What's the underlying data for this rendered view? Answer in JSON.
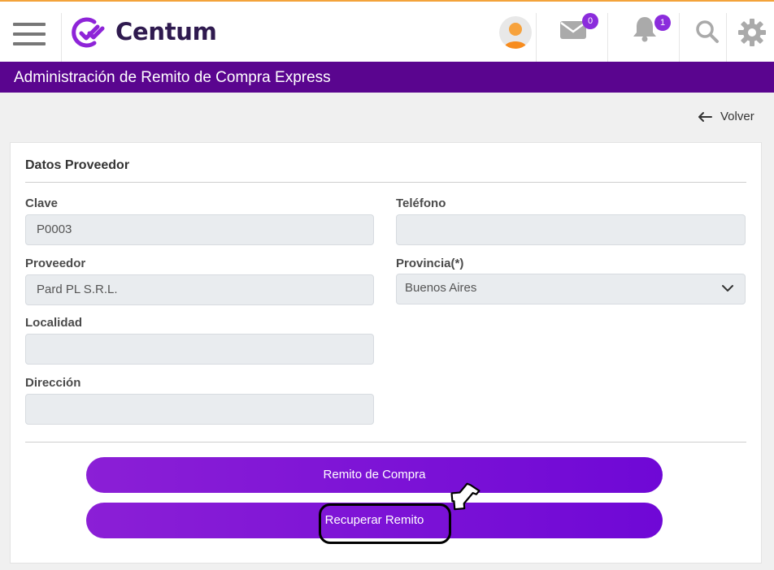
{
  "app": {
    "name": "Centum"
  },
  "header": {
    "mail_count": "0",
    "notification_count": "1"
  },
  "page": {
    "title": "Administración de Remito de Compra Express",
    "back_label": "Volver"
  },
  "form": {
    "section_title": "Datos Proveedor",
    "clave": {
      "label": "Clave",
      "value": "P0003"
    },
    "telefono": {
      "label": "Teléfono",
      "value": ""
    },
    "proveedor": {
      "label": "Proveedor",
      "value": "Pard PL S.R.L."
    },
    "provincia": {
      "label": "Provincia(*)",
      "value": "Buenos Aires"
    },
    "localidad": {
      "label": "Localidad",
      "value": ""
    },
    "direccion": {
      "label": "Dirección",
      "value": ""
    }
  },
  "actions": {
    "remito_compra": "Remito de Compra",
    "recuperar_remito": "Recuperar Remito"
  },
  "colors": {
    "brand": "#5a058f",
    "button": "#7a12d6",
    "badge": "#8b2cdc",
    "top_accent": "#f3a33a"
  },
  "icons": [
    "menu-icon",
    "centum-logo-icon",
    "user-avatar-icon",
    "mail-icon",
    "bell-icon",
    "search-icon",
    "gear-icon",
    "arrow-left-icon",
    "chevron-down-icon",
    "hand-pointer-icon"
  ]
}
